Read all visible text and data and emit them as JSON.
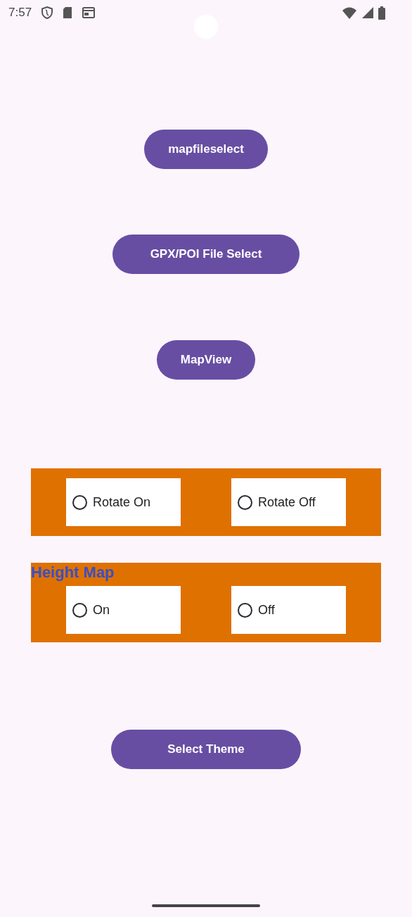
{
  "status_bar": {
    "time": "7:57"
  },
  "buttons": [
    "mapfileselect",
    "GPX/POI File Select",
    "MapView"
  ],
  "rotate": {
    "options": [
      {
        "label": "Rotate On",
        "selected": false
      },
      {
        "label": "Rotate Off",
        "selected": false
      }
    ]
  },
  "height_map": {
    "title": "Height Map",
    "options": [
      {
        "label": "On",
        "selected": false
      },
      {
        "label": "Off",
        "selected": false
      }
    ]
  },
  "theme_button": "Select Theme"
}
